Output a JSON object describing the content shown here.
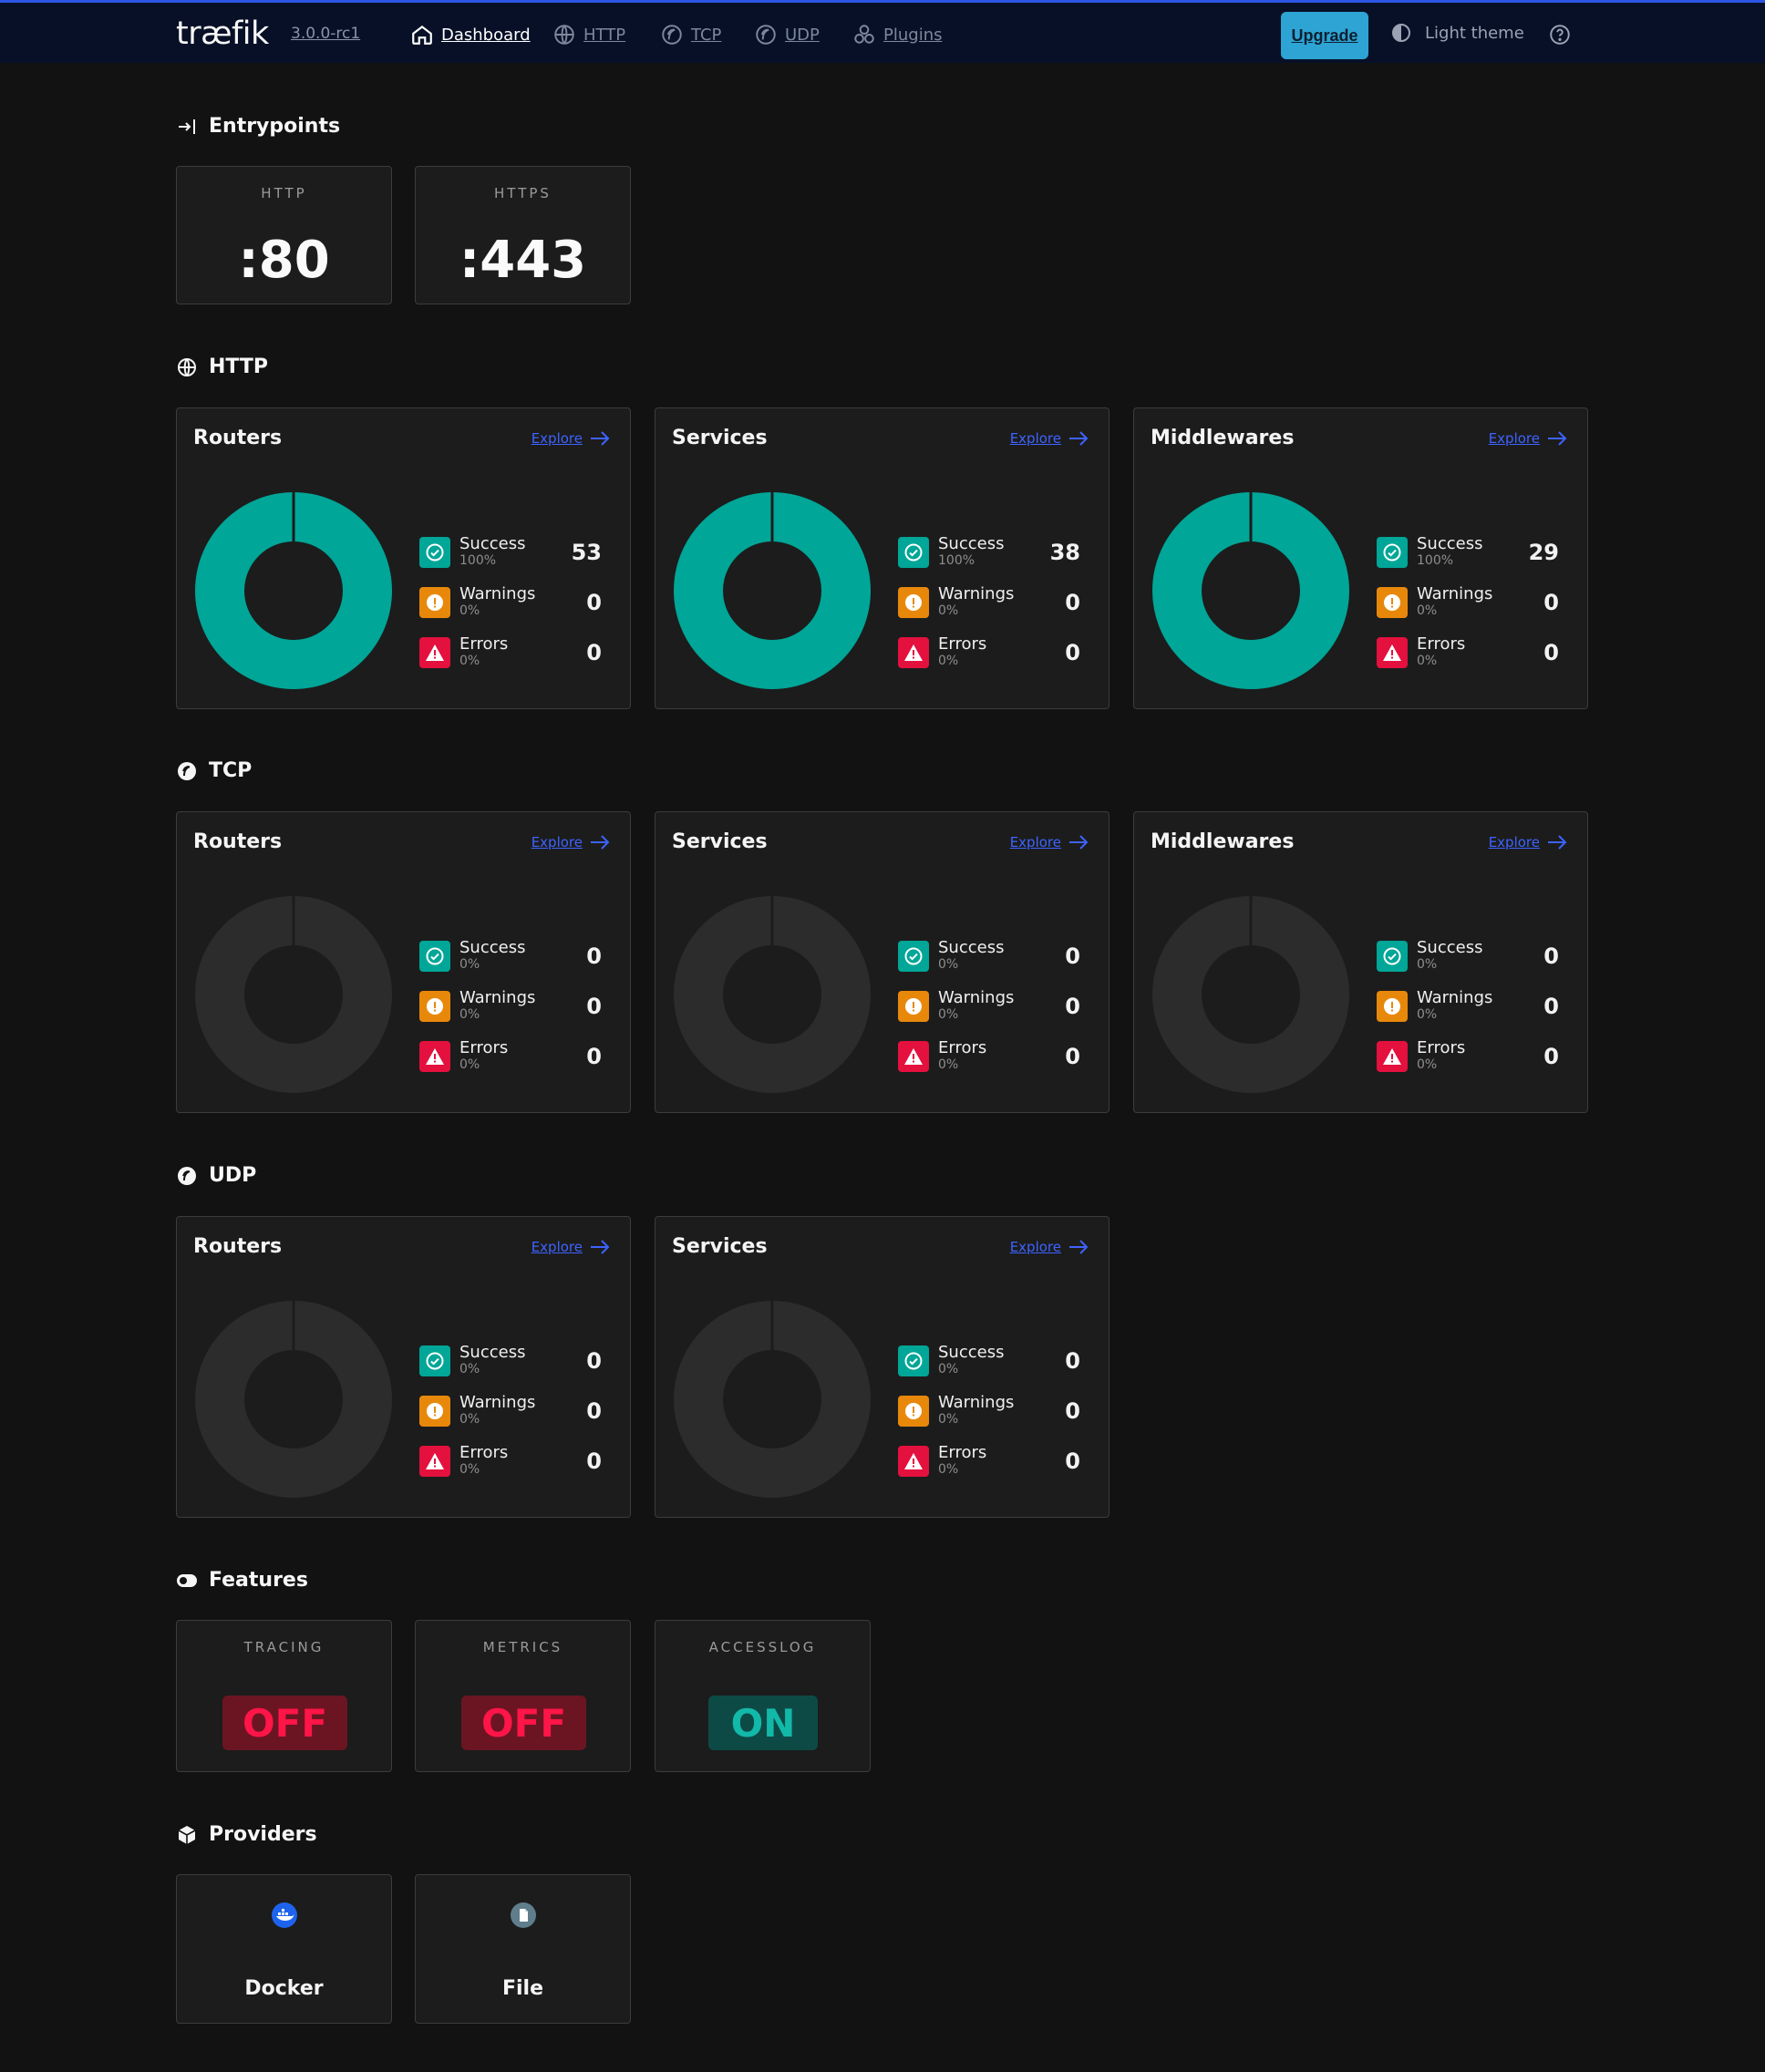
{
  "header": {
    "logo": "træfik",
    "version": "3.0.0-rc1",
    "nav": [
      "Dashboard",
      "HTTP",
      "TCP",
      "UDP",
      "Plugins"
    ],
    "active_nav": "Dashboard",
    "upgrade": "Upgrade",
    "theme": "Light theme"
  },
  "entrypoints": {
    "title": "Entrypoints",
    "items": [
      {
        "name": "HTTP",
        "value": ":80"
      },
      {
        "name": "HTTPS",
        "value": ":443"
      }
    ]
  },
  "http": {
    "title": "HTTP",
    "cards": [
      {
        "title": "Routers",
        "explore": "Explore",
        "success": {
          "label": "Success",
          "pct": "100%",
          "count": "53"
        },
        "warnings": {
          "label": "Warnings",
          "pct": "0%",
          "count": "0"
        },
        "errors": {
          "label": "Errors",
          "pct": "0%",
          "count": "0"
        }
      },
      {
        "title": "Services",
        "explore": "Explore",
        "success": {
          "label": "Success",
          "pct": "100%",
          "count": "38"
        },
        "warnings": {
          "label": "Warnings",
          "pct": "0%",
          "count": "0"
        },
        "errors": {
          "label": "Errors",
          "pct": "0%",
          "count": "0"
        }
      },
      {
        "title": "Middlewares",
        "explore": "Explore",
        "success": {
          "label": "Success",
          "pct": "100%",
          "count": "29"
        },
        "warnings": {
          "label": "Warnings",
          "pct": "0%",
          "count": "0"
        },
        "errors": {
          "label": "Errors",
          "pct": "0%",
          "count": "0"
        }
      }
    ]
  },
  "tcp": {
    "title": "TCP",
    "cards": [
      {
        "title": "Routers",
        "explore": "Explore",
        "success": {
          "label": "Success",
          "pct": "0%",
          "count": "0"
        },
        "warnings": {
          "label": "Warnings",
          "pct": "0%",
          "count": "0"
        },
        "errors": {
          "label": "Errors",
          "pct": "0%",
          "count": "0"
        }
      },
      {
        "title": "Services",
        "explore": "Explore",
        "success": {
          "label": "Success",
          "pct": "0%",
          "count": "0"
        },
        "warnings": {
          "label": "Warnings",
          "pct": "0%",
          "count": "0"
        },
        "errors": {
          "label": "Errors",
          "pct": "0%",
          "count": "0"
        }
      },
      {
        "title": "Middlewares",
        "explore": "Explore",
        "success": {
          "label": "Success",
          "pct": "0%",
          "count": "0"
        },
        "warnings": {
          "label": "Warnings",
          "pct": "0%",
          "count": "0"
        },
        "errors": {
          "label": "Errors",
          "pct": "0%",
          "count": "0"
        }
      }
    ]
  },
  "udp": {
    "title": "UDP",
    "cards": [
      {
        "title": "Routers",
        "explore": "Explore",
        "success": {
          "label": "Success",
          "pct": "0%",
          "count": "0"
        },
        "warnings": {
          "label": "Warnings",
          "pct": "0%",
          "count": "0"
        },
        "errors": {
          "label": "Errors",
          "pct": "0%",
          "count": "0"
        }
      },
      {
        "title": "Services",
        "explore": "Explore",
        "success": {
          "label": "Success",
          "pct": "0%",
          "count": "0"
        },
        "warnings": {
          "label": "Warnings",
          "pct": "0%",
          "count": "0"
        },
        "errors": {
          "label": "Errors",
          "pct": "0%",
          "count": "0"
        }
      }
    ]
  },
  "features": {
    "title": "Features",
    "items": [
      {
        "name": "TRACING",
        "status": "OFF"
      },
      {
        "name": "METRICS",
        "status": "OFF"
      },
      {
        "name": "ACCESSLOG",
        "status": "ON"
      }
    ]
  },
  "providers": {
    "title": "Providers",
    "items": [
      {
        "name": "Docker",
        "icon": "docker-icon"
      },
      {
        "name": "File",
        "icon": "file-icon"
      }
    ]
  },
  "colors": {
    "success": "#00a697",
    "warning": "#e8880b",
    "error": "#e4103e",
    "empty_ring": "#2c2c2c",
    "link": "#3d63ff"
  }
}
